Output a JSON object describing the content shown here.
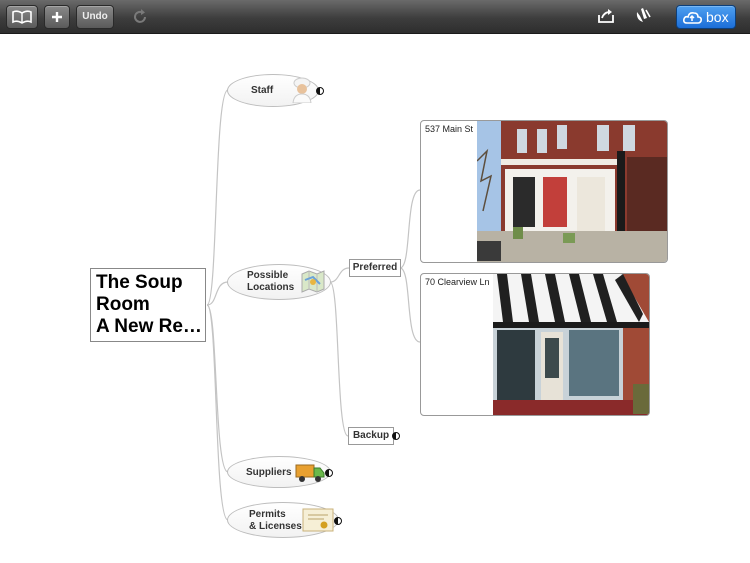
{
  "toolbar": {
    "undo_label": "Undo",
    "share_label": "",
    "box_label": "box",
    "icons": [
      "book-icon",
      "plus-icon",
      "redo-icon",
      "share-icon",
      "palette-icon",
      "cloud-upload-icon"
    ]
  },
  "map": {
    "root_lines": [
      "The Soup",
      "Room",
      "A New Re…"
    ],
    "branches": {
      "staff": "Staff",
      "locations": [
        "Possible",
        "Locations"
      ],
      "suppliers": "Suppliers",
      "permits": [
        "Permits",
        "& Licenses"
      ]
    },
    "subnodes": {
      "preferred": "Preferred",
      "backup": "Backup"
    },
    "photos": {
      "main_st": "537 Main St",
      "clearview": "70 Clearview Ln"
    }
  }
}
